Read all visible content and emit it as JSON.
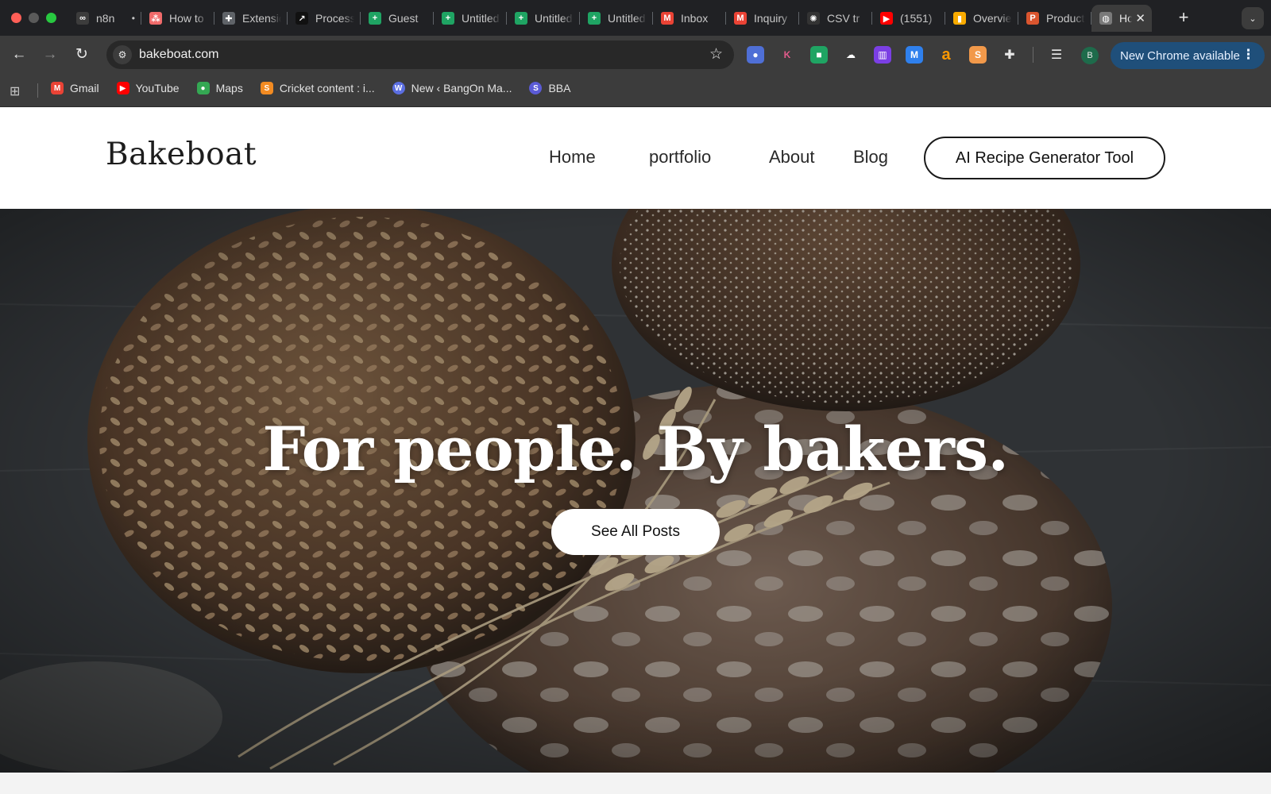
{
  "browser": {
    "tabs": [
      {
        "title": "n8n",
        "suffix": "•",
        "icon": "n8n-icon",
        "color": "#3c3c3c",
        "glyph": "∞"
      },
      {
        "title": "How to",
        "icon": "asana-icon",
        "color": "#f06a6a",
        "glyph": "⁂"
      },
      {
        "title": "Extensions",
        "icon": "puzzle-icon",
        "color": "#5f6368",
        "glyph": "✚"
      },
      {
        "title": "Process",
        "icon": "process-icon",
        "color": "#111111",
        "glyph": "↗"
      },
      {
        "title": "Guest",
        "icon": "sheets-icon",
        "color": "#1fa463",
        "glyph": "+"
      },
      {
        "title": "Untitled",
        "icon": "sheets-icon",
        "color": "#1fa463",
        "glyph": "+"
      },
      {
        "title": "Untitled",
        "icon": "sheets-icon",
        "color": "#1fa463",
        "glyph": "+"
      },
      {
        "title": "Untitled",
        "icon": "sheets-icon",
        "color": "#1fa463",
        "glyph": "+"
      },
      {
        "title": "Inbox",
        "icon": "gmail-icon",
        "color": "#ea4335",
        "glyph": "M"
      },
      {
        "title": "Inquiry",
        "icon": "gmail-icon",
        "color": "#ea4335",
        "glyph": "M"
      },
      {
        "title": "CSV tr",
        "icon": "openai-icon",
        "color": "#333333",
        "glyph": "✺"
      },
      {
        "title": "(1551)",
        "icon": "youtube-icon",
        "color": "#ff0000",
        "glyph": "▶"
      },
      {
        "title": "Overview",
        "icon": "analytics-icon",
        "color": "#f9ab00",
        "glyph": "▮"
      },
      {
        "title": "Product",
        "icon": "producthunt-icon",
        "color": "#da552f",
        "glyph": "P"
      }
    ],
    "active_tab": {
      "title": "Home",
      "icon": "globe-icon",
      "color": "#7a7a7a",
      "glyph": "◍",
      "close": "✕"
    },
    "new_tab": "+",
    "tab_search": "⌄",
    "back": "←",
    "forward": "→",
    "reload": "↻",
    "site_info": "⚙",
    "url": "bakeboat.com",
    "bookmark_star": "☆",
    "extensions": [
      {
        "name": "colorzilla-icon",
        "color": "#4f6fd6",
        "glyph": "●"
      },
      {
        "name": "k-extension-icon",
        "color": "#3c3c3c",
        "glyph": "K"
      },
      {
        "name": "shield-extension-icon",
        "color": "#1fa463",
        "glyph": "■"
      },
      {
        "name": "cloud-extension-icon",
        "color": "#3c3c3c",
        "glyph": "☁"
      },
      {
        "name": "chart-extension-icon",
        "color": "#7b3fe4",
        "glyph": "▥"
      },
      {
        "name": "m-extension-icon",
        "color": "#2f80ed",
        "glyph": "M"
      },
      {
        "name": "amazon-icon",
        "color": "#3c3c3c",
        "glyph": "a"
      },
      {
        "name": "seo-extension-icon",
        "color": "#f2994a",
        "glyph": "S"
      },
      {
        "name": "puzzle-icon",
        "color": "#3c3c3c",
        "glyph": "✚"
      }
    ],
    "reading_list": "☰",
    "profile": "B",
    "update_label": "New Chrome available",
    "update_menu": "⋮",
    "apps_icon": "⊞",
    "bookmarks": [
      {
        "label": "Gmail",
        "icon": "gmail-icon",
        "color": "#ea4335",
        "glyph": "M"
      },
      {
        "label": "YouTube",
        "icon": "youtube-icon",
        "color": "#ff0000",
        "glyph": "▶"
      },
      {
        "label": "Maps",
        "icon": "maps-icon",
        "color": "#34a853",
        "glyph": "●"
      },
      {
        "label": "Cricket content : i...",
        "icon": "cricket-icon",
        "color": "#f28b22",
        "glyph": "S"
      },
      {
        "label": "New ‹ BangOn Ma...",
        "icon": "wordpress-icon",
        "color": "#5b6ee1",
        "glyph": "W"
      },
      {
        "label": "BBA",
        "icon": "s-bookmark-icon",
        "color": "#5b5bd6",
        "glyph": "S"
      }
    ]
  },
  "site": {
    "logo": "Bakeboat",
    "nav": [
      {
        "label": "Home"
      },
      {
        "label": "portfolio"
      },
      {
        "label": "About"
      },
      {
        "label": "Blog"
      }
    ],
    "cta": "AI Recipe Generator Tool",
    "hero": {
      "title": "For people. By bakers.",
      "button": "See All Posts"
    }
  }
}
